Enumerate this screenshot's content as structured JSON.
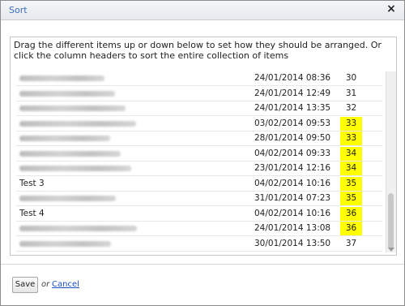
{
  "dialog": {
    "title": "Sort",
    "close_symbol": "×",
    "instructions": "Drag the different items up or down below to set how they should be arranged. Or click the column headers to sort the entire collection of items"
  },
  "rows": [
    {
      "name": "",
      "blurred": true,
      "date": "24/01/2014 08:36",
      "value": "30",
      "highlight": false
    },
    {
      "name": "",
      "blurred": true,
      "date": "24/01/2014 12:49",
      "value": "31",
      "highlight": false
    },
    {
      "name": "",
      "blurred": true,
      "date": "24/01/2014 13:35",
      "value": "32",
      "highlight": false
    },
    {
      "name": "",
      "blurred": true,
      "date": "03/02/2014 09:53",
      "value": "33",
      "highlight": true
    },
    {
      "name": "",
      "blurred": true,
      "date": "28/01/2014 09:50",
      "value": "33",
      "highlight": true
    },
    {
      "name": "",
      "blurred": true,
      "date": "04/02/2014 09:33",
      "value": "34",
      "highlight": true
    },
    {
      "name": "",
      "blurred": true,
      "date": "23/01/2014 12:16",
      "value": "34",
      "highlight": true
    },
    {
      "name": "Test 3",
      "blurred": false,
      "date": "04/02/2014 10:16",
      "value": "35",
      "highlight": true
    },
    {
      "name": "",
      "blurred": true,
      "date": "31/01/2014 07:23",
      "value": "35",
      "highlight": true
    },
    {
      "name": "Test 4",
      "blurred": false,
      "date": "04/02/2014 10:16",
      "value": "36",
      "highlight": true
    },
    {
      "name": "",
      "blurred": true,
      "date": "24/01/2014 13:08",
      "value": "36",
      "highlight": true
    },
    {
      "name": "",
      "blurred": true,
      "date": "30/01/2014 13:50",
      "value": "37",
      "highlight": false
    }
  ],
  "footer": {
    "save_label": "Save",
    "or_label": "or",
    "cancel_label": "Cancel"
  },
  "colors": {
    "highlight": "#ffff00",
    "title": "#3b6fb6",
    "link": "#1c4fc2"
  }
}
